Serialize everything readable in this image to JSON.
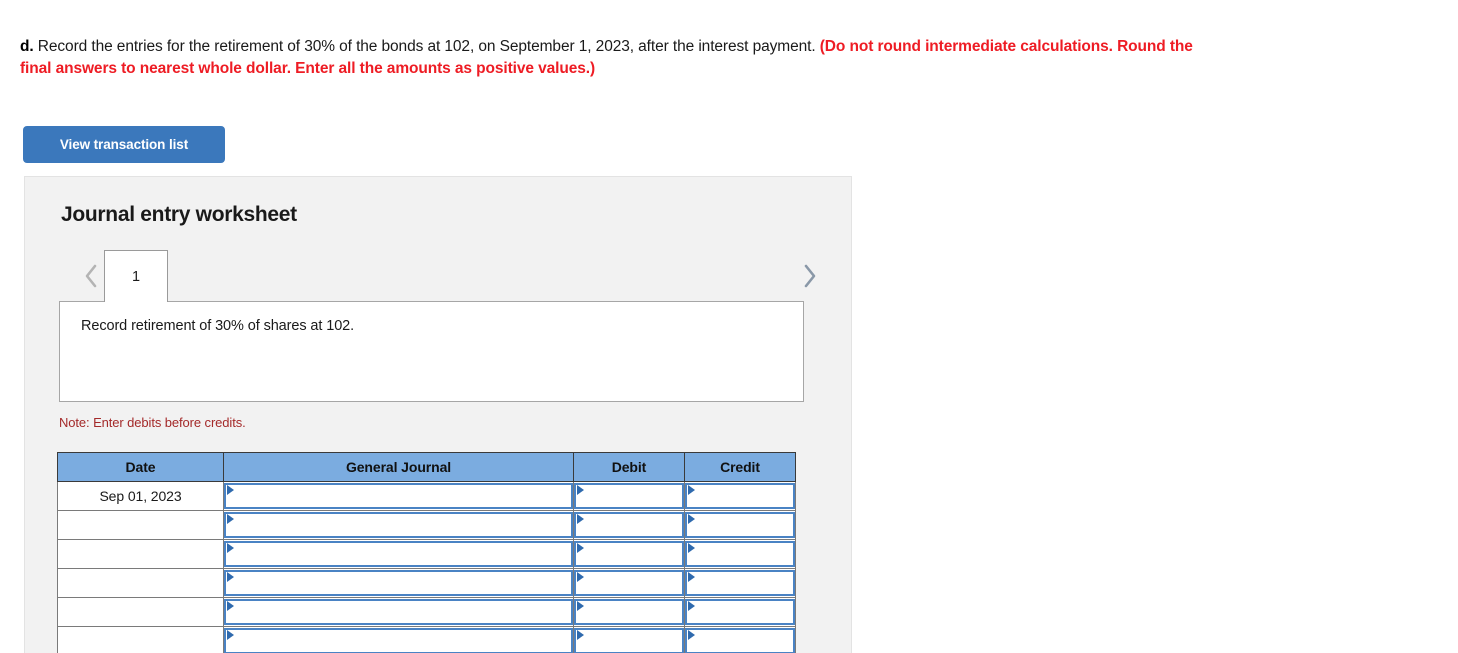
{
  "prompt": {
    "letter": "d.",
    "body": " Record the entries for the retirement of 30% of the bonds at 102, on September 1, 2023, after the interest payment. ",
    "red_note": "(Do not round intermediate calculations. Round the final answers to nearest whole dollar. Enter all the amounts as positive values.)"
  },
  "toolbar": {
    "view_transaction_list_label": "View transaction list"
  },
  "worksheet": {
    "title": "Journal entry worksheet",
    "tabs": [
      {
        "label": "1",
        "active": true
      }
    ],
    "prev_arrow_icon": "chevron-left-icon",
    "next_arrow_icon": "chevron-right-icon",
    "description": "Record retirement of 30% of shares at 102.",
    "note": "Note: Enter debits before credits."
  },
  "journal_table": {
    "columns": [
      "Date",
      "General Journal",
      "Debit",
      "Credit"
    ],
    "rows": [
      {
        "date": "Sep 01, 2023",
        "general_journal": "",
        "debit": "",
        "credit": ""
      },
      {
        "date": "",
        "general_journal": "",
        "debit": "",
        "credit": ""
      },
      {
        "date": "",
        "general_journal": "",
        "debit": "",
        "credit": ""
      },
      {
        "date": "",
        "general_journal": "",
        "debit": "",
        "credit": ""
      },
      {
        "date": "",
        "general_journal": "",
        "debit": "",
        "credit": ""
      },
      {
        "date": "",
        "general_journal": "",
        "debit": "",
        "credit": ""
      }
    ]
  },
  "colors": {
    "button_blue": "#3b78bc",
    "header_blue": "#7bace0",
    "input_border_blue": "#4a83c4",
    "red_note": "#ee1c24",
    "note_maroon": "#a42a2a",
    "panel_grey": "#f2f2f2"
  }
}
